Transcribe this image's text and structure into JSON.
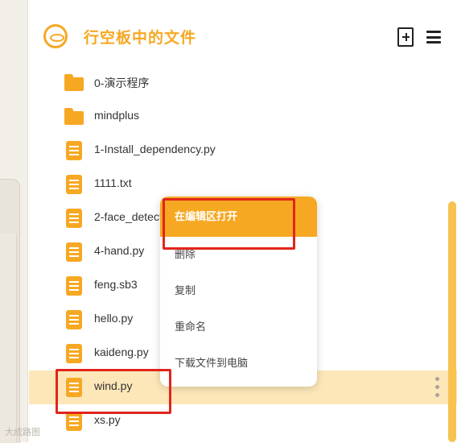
{
  "header": {
    "title": "行空板中的文件",
    "new_file_icon": "new-file-icon",
    "menu_icon": "hamburger-menu-icon",
    "accent_color": "#f6a823"
  },
  "files": [
    {
      "name": "0-演示程序",
      "type": "folder"
    },
    {
      "name": "mindplus",
      "type": "folder"
    },
    {
      "name": "1-Install_dependency.py",
      "type": "file"
    },
    {
      "name": "1111.txt",
      "type": "file"
    },
    {
      "name": "2-face_detect",
      "type": "file"
    },
    {
      "name": "4-hand.py",
      "type": "file"
    },
    {
      "name": "feng.sb3",
      "type": "file"
    },
    {
      "name": "hello.py",
      "type": "file"
    },
    {
      "name": "kaideng.py",
      "type": "file"
    },
    {
      "name": "wind.py",
      "type": "file",
      "selected": true
    },
    {
      "name": "xs.py",
      "type": "file"
    }
  ],
  "context_menu": {
    "items": [
      {
        "label": "在编辑区打开",
        "active": true
      },
      {
        "label": "删除"
      },
      {
        "label": "复制"
      },
      {
        "label": "重命名"
      },
      {
        "label": "下载文件到电脑"
      }
    ]
  },
  "watermark": "大成路图"
}
